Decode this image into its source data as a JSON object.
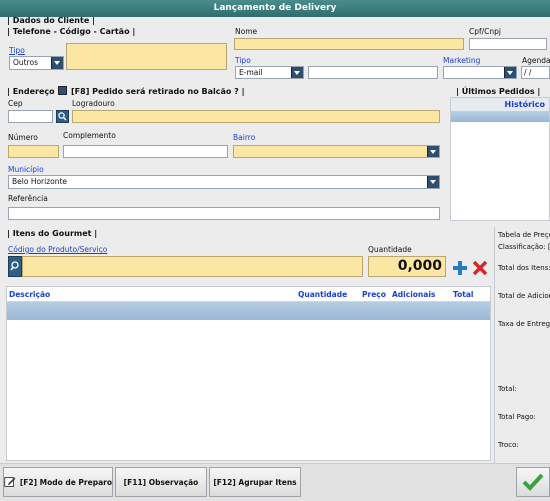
{
  "window": {
    "title": "Lançamento de Delivery"
  },
  "client": {
    "section_title": "| Dados do Cliente |",
    "phone_section": "| Telefone - Código - Cartão |",
    "tipo_label": "Tipo",
    "tipo_value": "Outros",
    "nome_label": "Nome",
    "cpf_label": "Cpf/Cnpj",
    "tipo2_label": "Tipo",
    "tipo2_value": "E-mail",
    "marketing_label": "Marketing",
    "agendar_label": "Agendar",
    "agendar_value": " / /"
  },
  "address": {
    "section_title": "| Endereço",
    "balcao_label": "[F8] Pedido será retirado no Balcão ? |",
    "cep_label": "Cep",
    "logradouro_label": "Logradouro",
    "numero_label": "Número",
    "complemento_label": "Complemento",
    "bairro_label": "Bairro",
    "municipio_label": "Município",
    "municipio_value": "Belo Horizonte",
    "referencia_label": "Referência"
  },
  "orders": {
    "section_title": "| Últimos Pedidos |",
    "col_historico": "Histórico"
  },
  "items": {
    "section_title": "| Itens do Gourmet |",
    "codigo_label": "Código do Produto/Serviço",
    "quantidade_label": "Quantidade",
    "quantidade_value": "0,000",
    "columns": [
      "Descrição",
      "Quantidade",
      "Preço",
      "Adicionais",
      "Total"
    ]
  },
  "summary": {
    "tabela": "Tabela de Preço",
    "classificacao": "Classificação: [A",
    "total_itens": "Total dos Itens:",
    "total_adicionais": "Total de Adicion",
    "taxa_entrega": "Taxa de Entrega",
    "total": "Total:",
    "total_pago": "Total Pago:",
    "troco": "Troco:"
  },
  "toolbar": {
    "modo_preparo": "[F2] Modo de Preparo",
    "observacao": "[F11] Observação",
    "agrupar": "[F12] Agrupar Itens"
  },
  "colors": {
    "title_bar": "#3a7d7c",
    "highlight_field": "#fce6a4",
    "selection_row": "#a9c4dc",
    "add_icon": "#2a78c8",
    "remove_icon": "#d8262a",
    "confirm_icon": "#3aa43a"
  }
}
